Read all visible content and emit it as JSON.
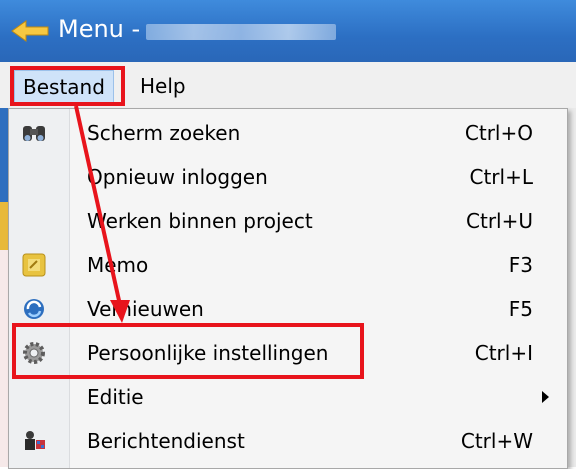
{
  "window": {
    "title": "Menu -",
    "title_redacted": true
  },
  "menubar": {
    "items": [
      {
        "label": "Bestand"
      },
      {
        "label": "Help"
      }
    ]
  },
  "dropdown": {
    "items": [
      {
        "label": "Scherm zoeken",
        "shortcut": "Ctrl+O",
        "icon": "binoculars-icon"
      },
      {
        "label": "Opnieuw inloggen",
        "shortcut": "Ctrl+L",
        "icon": ""
      },
      {
        "label": "Werken binnen project",
        "shortcut": "Ctrl+U",
        "icon": ""
      },
      {
        "label": "Memo",
        "shortcut": "F3",
        "icon": "memo-icon"
      },
      {
        "label": "Vernieuwen",
        "shortcut": "F5",
        "icon": "refresh-icon"
      },
      {
        "label": "Persoonlijke instellingen",
        "shortcut": "Ctrl+I",
        "icon": "gear-icon"
      },
      {
        "label": "Editie",
        "shortcut": "",
        "icon": "",
        "has_submenu": true
      },
      {
        "label": "Berichtendienst",
        "shortcut": "Ctrl+W",
        "icon": "messenger-icon"
      }
    ]
  },
  "annotation": {
    "color": "#e8141c"
  }
}
